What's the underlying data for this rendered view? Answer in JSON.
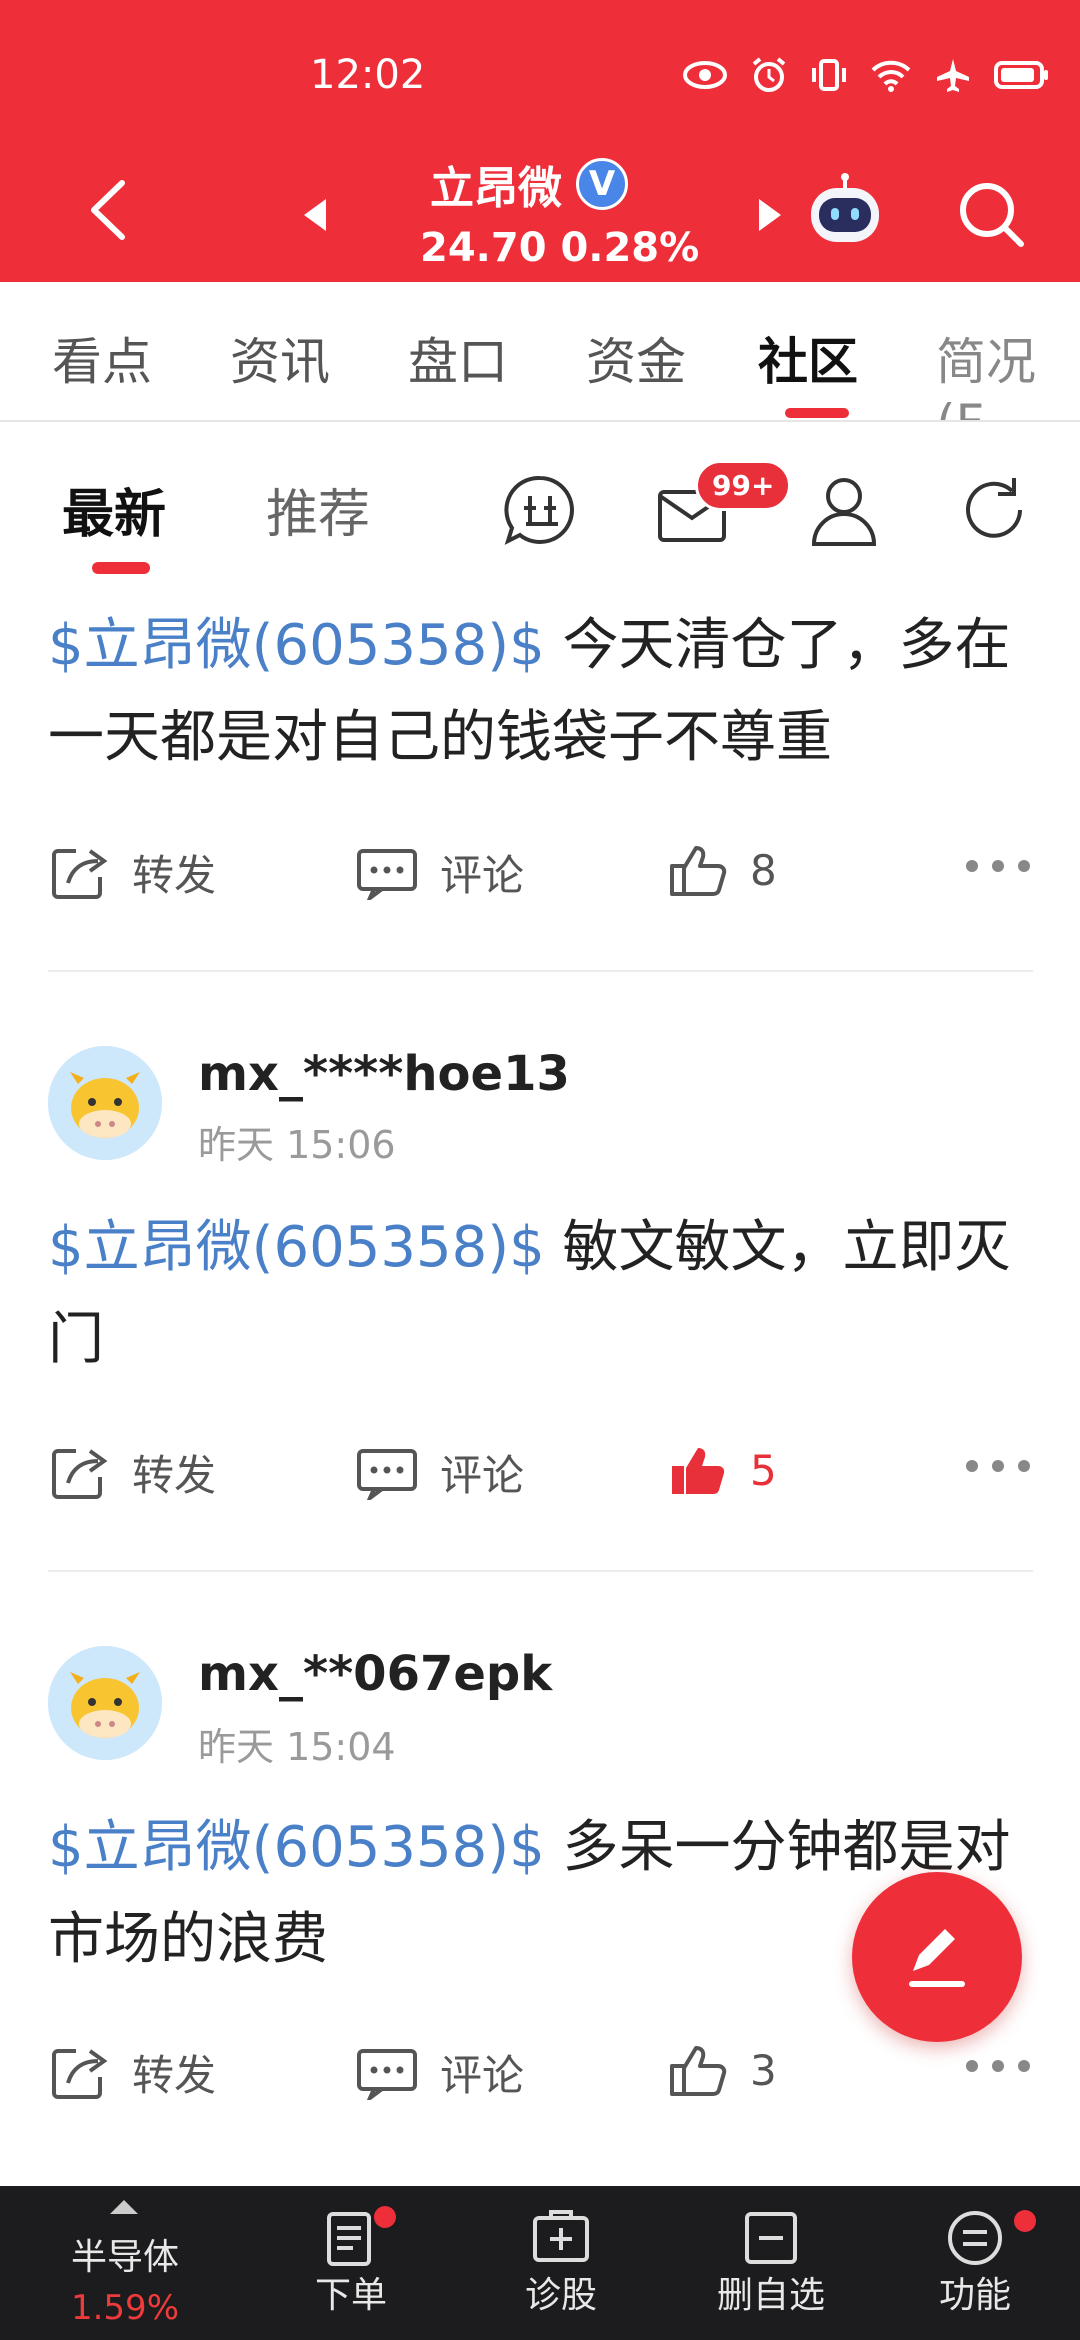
{
  "status_bar": {
    "time": "12:02"
  },
  "header": {
    "stock_name": "立昂微",
    "verified_mark": "V",
    "price_line": "24.70 0.28%",
    "icons": [
      "back-icon",
      "prev-stock-icon",
      "next-stock-icon",
      "robot-icon",
      "search-icon"
    ],
    "bg_color": "#ee2f3a"
  },
  "tabs": [
    {
      "label": "看点"
    },
    {
      "label": "资讯"
    },
    {
      "label": "盘口"
    },
    {
      "label": "资金"
    },
    {
      "label": "社区",
      "active": true
    },
    {
      "label": "简况(F"
    }
  ],
  "subtabs": {
    "latest": "最新",
    "recommend": "推荐",
    "message_badge": "99+"
  },
  "posts": [
    {
      "tag": "$立昂微(605358)$",
      "text": " 今天清仓了，多在一天都是对自己的钱袋子不尊重",
      "forward": "转发",
      "comment": "评论",
      "likes": "8",
      "liked": false
    },
    {
      "user": "mx_****hoe13",
      "time": "昨天 15:06",
      "tag": "$立昂微(605358)$",
      "text": " 敏文敏文，立即灭门",
      "forward": "转发",
      "comment": "评论",
      "likes": "5",
      "liked": true
    },
    {
      "user": "mx_**067epk",
      "time": "昨天 15:04",
      "tag": "$立昂微(605358)$",
      "text": " 多呆一分钟都是对市场的浪费",
      "forward": "转发",
      "comment": "评论",
      "likes": "3",
      "liked": false
    }
  ],
  "bottom_bar": {
    "sector_name": "半导体",
    "sector_change": "1.59%",
    "items": [
      {
        "label": "下单"
      },
      {
        "label": "诊股"
      },
      {
        "label": "删自选"
      },
      {
        "label": "功能"
      }
    ]
  },
  "colors": {
    "accent": "#ee2f3a",
    "tag_blue": "#4a80c8",
    "liked_red": "#e8303a"
  }
}
